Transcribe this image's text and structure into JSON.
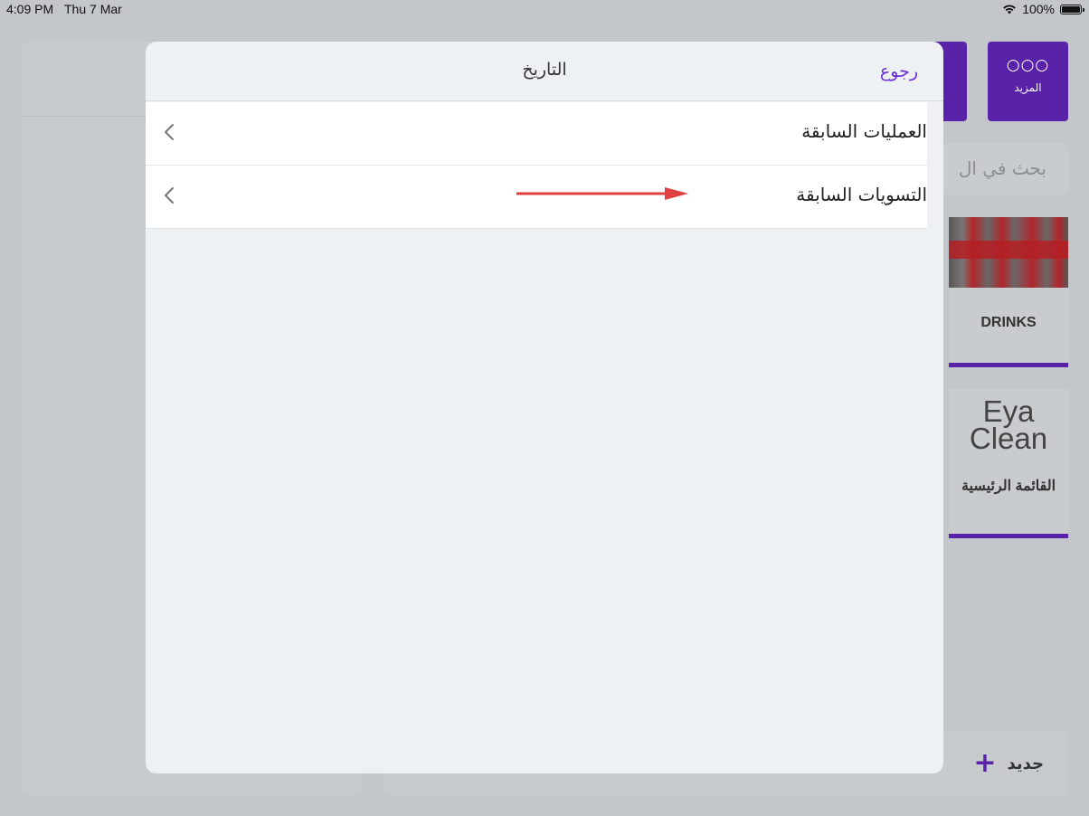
{
  "status_bar": {
    "time": "4:09 PM",
    "date": "Thu 7 Mar",
    "battery": "100%"
  },
  "background": {
    "more_button": {
      "icon": "more-dots-icon",
      "label": "المزيد"
    },
    "search_placeholder": "بحث في ال",
    "categories": [
      {
        "label": "DRINKS"
      },
      {
        "label": "القائمة الرئيسية",
        "logo_line1": "Eya",
        "logo_line2": "Clean"
      }
    ],
    "new_button": {
      "label": "جديد"
    },
    "colors": {
      "accent": "#5a22a8"
    }
  },
  "modal": {
    "title": "التاريخ",
    "back_label": "رجوع",
    "items": [
      {
        "label": "العمليات السابقة"
      },
      {
        "label": "التسويات السابقة"
      }
    ],
    "colors": {
      "link": "#6a30d6",
      "annotation_arrow": "#e04040"
    }
  }
}
